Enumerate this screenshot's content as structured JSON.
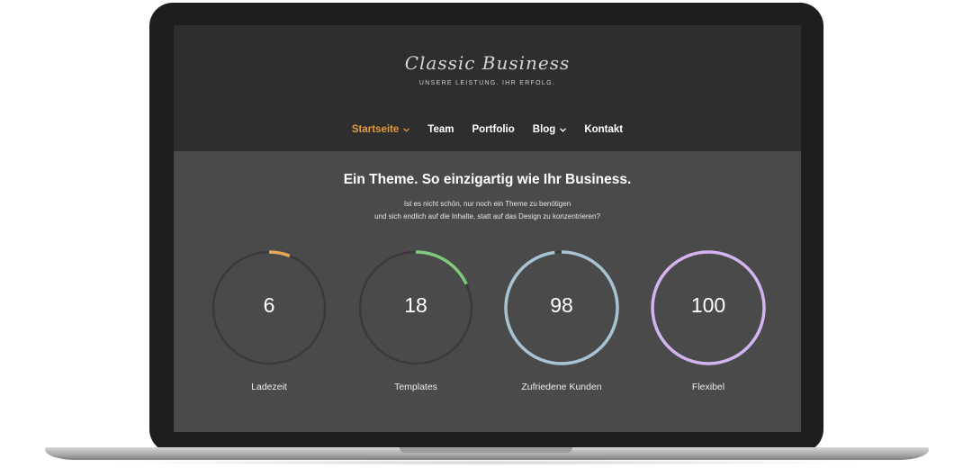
{
  "site": {
    "title": "Classic Business",
    "tagline": "UNSERE LEISTUNG. IHR ERFOLG."
  },
  "nav": {
    "items": [
      {
        "label": "Startseite",
        "active": true,
        "has_dropdown": true
      },
      {
        "label": "Team",
        "active": false,
        "has_dropdown": false
      },
      {
        "label": "Portfolio",
        "active": false,
        "has_dropdown": false
      },
      {
        "label": "Blog",
        "active": false,
        "has_dropdown": true
      },
      {
        "label": "Kontakt",
        "active": false,
        "has_dropdown": false
      }
    ]
  },
  "hero": {
    "title": "Ein Theme. So einzigartig wie Ihr Business.",
    "text_line1": "Ist es nicht schön, nur noch ein Theme zu benötigen",
    "text_line2": "und sich endlich auf die Inhalte, statt auf das Design zu konzentrieren?"
  },
  "counters": [
    {
      "value": "6",
      "label": "Ladezeit",
      "percent": 6,
      "color": "#e8a65a"
    },
    {
      "value": "18",
      "label": "Templates",
      "percent": 18,
      "color": "#7fc97a"
    },
    {
      "value": "98",
      "label": "Zufriedene Kunden",
      "percent": 98,
      "color": "#a8c4d4"
    },
    {
      "value": "100",
      "label": "Flexibel",
      "percent": 100,
      "color": "#d3b3f0"
    }
  ],
  "colors": {
    "accent": "#e09a3e",
    "header_bg": "#2e2e2e",
    "hero_bg": "#4a4a4a",
    "track": "#3a3a3a"
  }
}
